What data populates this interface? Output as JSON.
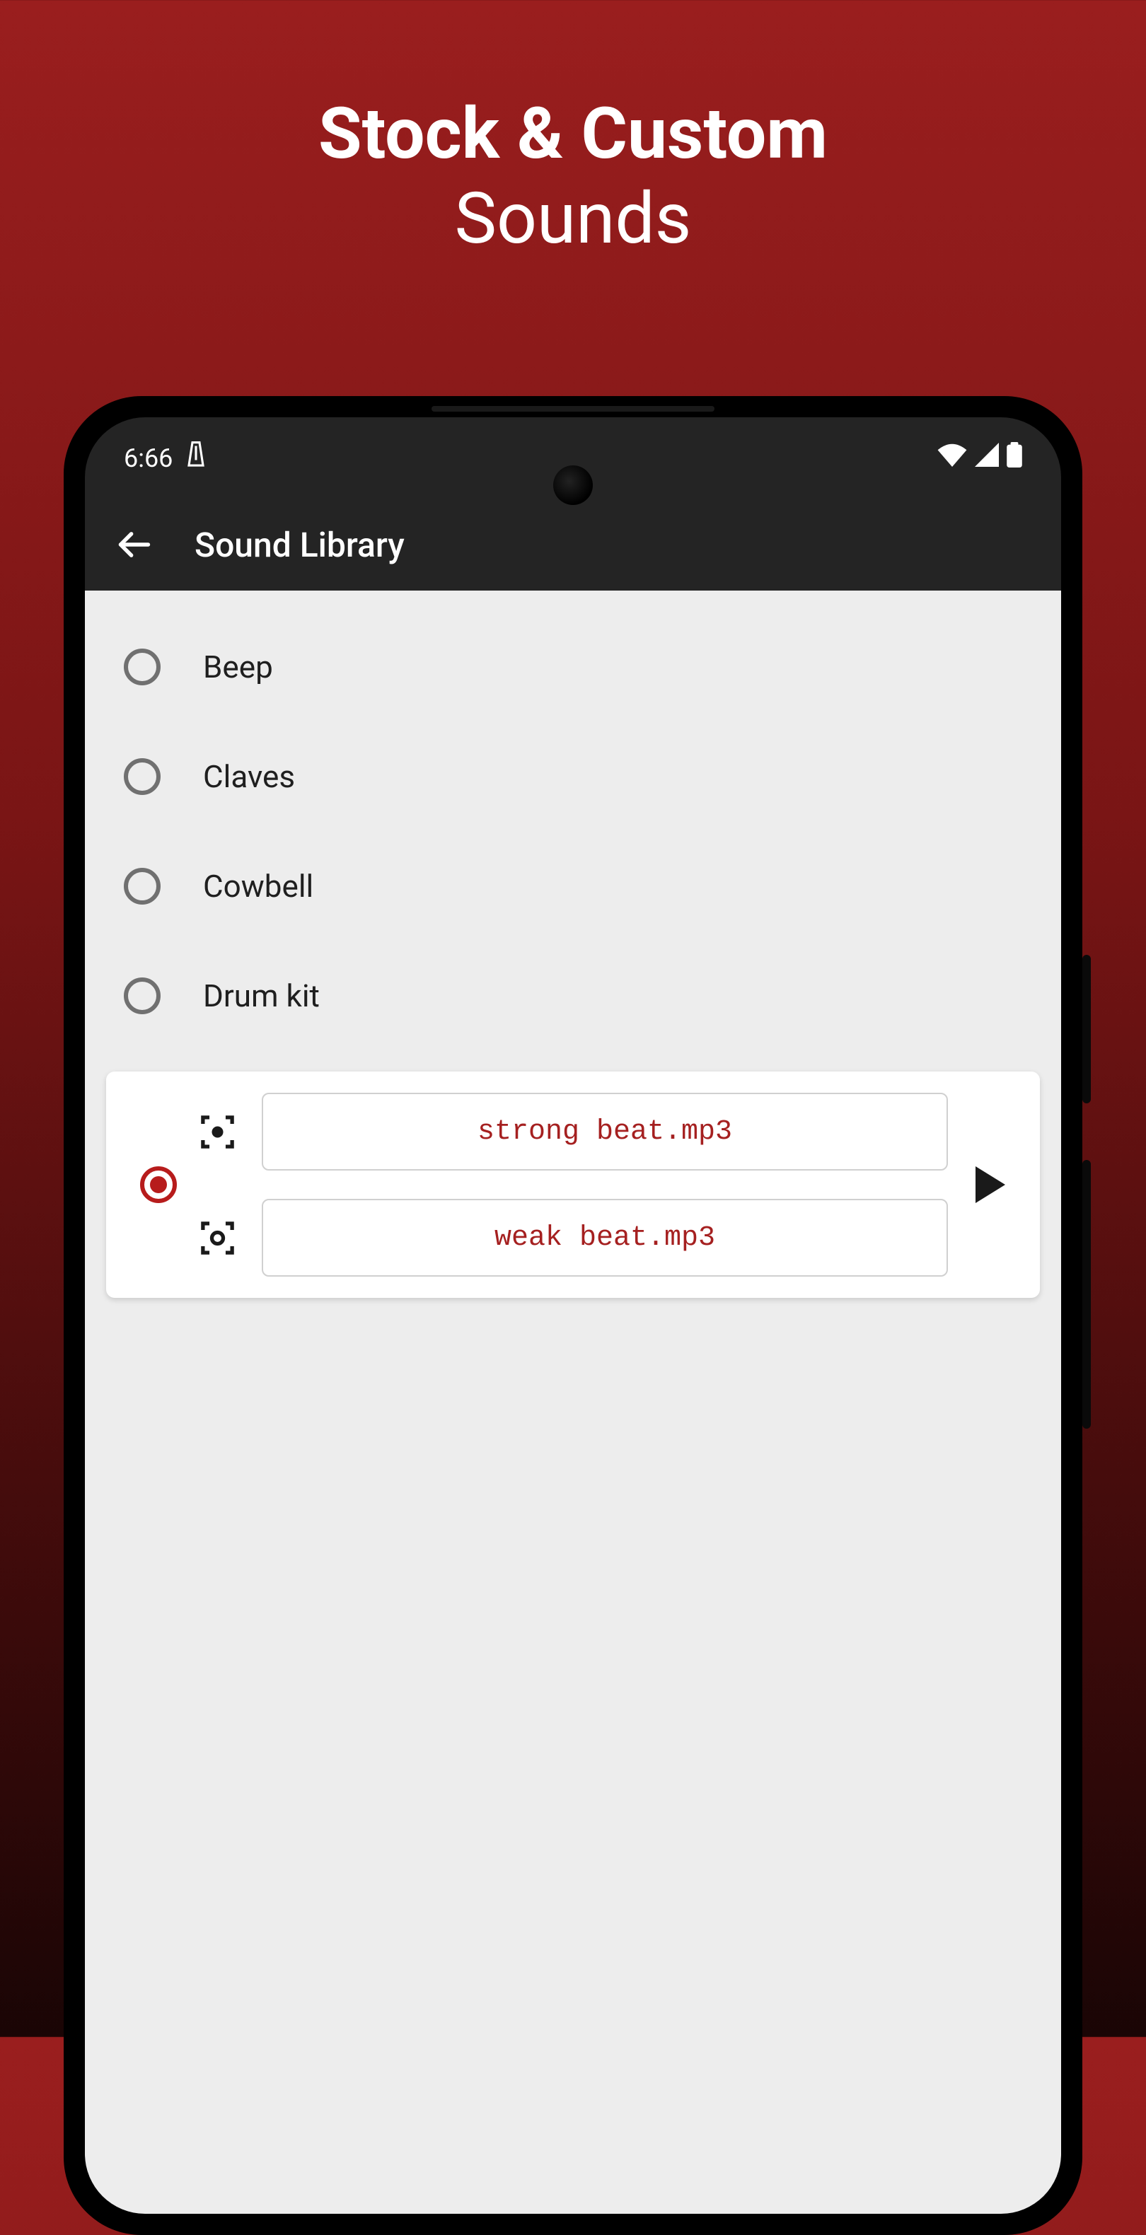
{
  "promo": {
    "line1": "Stock & Custom",
    "line2": "Sounds"
  },
  "status": {
    "time": "6:66"
  },
  "appbar": {
    "title": "Sound Library"
  },
  "sounds": [
    {
      "label": "Beep"
    },
    {
      "label": "Claves"
    },
    {
      "label": "Cowbell"
    },
    {
      "label": "Drum kit"
    }
  ],
  "custom": {
    "files": [
      {
        "name": "strong beat.mp3"
      },
      {
        "name": "weak beat.mp3"
      }
    ]
  },
  "accent_color": "#b71c1c"
}
